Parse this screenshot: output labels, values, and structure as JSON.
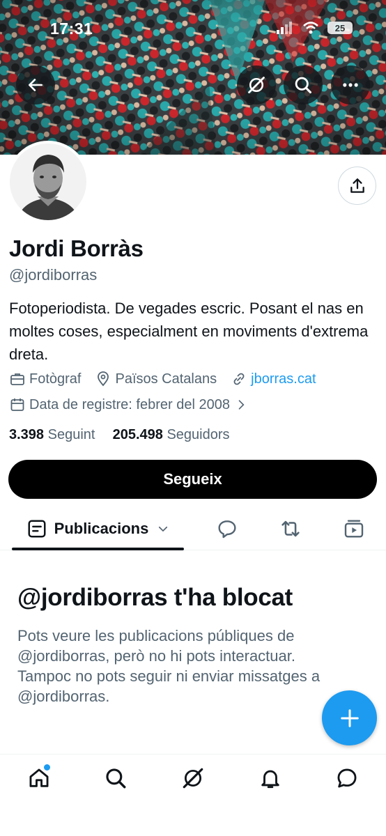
{
  "status_bar": {
    "time": "17:31",
    "battery": "25"
  },
  "profile": {
    "name": "Jordi Borràs",
    "handle": "@jordiborras",
    "bio": "Fotoperiodista. De vegades escric. Posant el nas en moltes coses, especialment en moviments d'extrema dreta.",
    "category": "Fotògraf",
    "location": "Països Catalans",
    "website": "jborras.cat",
    "joined": "Data de registre: febrer del 2008"
  },
  "stats": {
    "following_count": "3.398",
    "following_label": "Seguint",
    "followers_count": "205.498",
    "followers_label": "Seguidors"
  },
  "follow_button": "Segueix",
  "tabs": {
    "main_label": "Publicacions"
  },
  "blocked": {
    "title": "@jordiborras t'ha blocat",
    "text": "Pots veure les publicacions públiques de @jordiborras, però no hi pots interactuar. Tampoc no pots seguir ni enviar missatges a @jordiborras."
  },
  "icons": {
    "back": "arrow-left-icon",
    "grok": "grok-icon",
    "search": "search-icon",
    "more": "more-icon",
    "share": "share-icon",
    "compose": "plus-icon",
    "nav": [
      "home-icon",
      "search-icon",
      "grok-icon",
      "bell-icon",
      "messages-icon"
    ]
  },
  "colors": {
    "accent": "#1d9bf0",
    "text": "#0f1419",
    "secondary": "#536471",
    "banner_teal": "#2fa3a3",
    "banner_red": "#d8262c"
  }
}
